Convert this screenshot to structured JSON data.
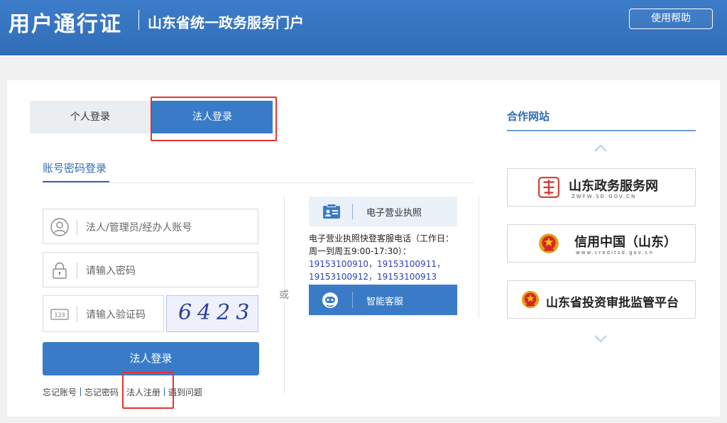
{
  "header": {
    "brand": "用户通行证",
    "subtitle": "山东省统一政务服务门户",
    "help_label": "使用帮助"
  },
  "tabs": {
    "person_label": "个人登录",
    "legal_label": "法人登录",
    "active": "法人登录"
  },
  "login": {
    "subtab_label": "账号密码登录",
    "account_placeholder": "法人/管理员/经办人账号",
    "password_placeholder": "请输入密码",
    "captcha_placeholder": "请输入验证码",
    "captcha_value": "6423",
    "captcha_icon_text": "123",
    "submit_label": "法人登录",
    "links": [
      "忘记账号",
      "忘记密码",
      "法人注册",
      "遇到问题"
    ]
  },
  "alt": {
    "or_label": "或",
    "elicense_label": "电子营业执照",
    "info_line1": "电子营业执照快登客服电话（工作日：",
    "info_line2": "周一到周五9:00-17:30）：",
    "phones_line1": "19153100910，19153100911，",
    "phones_line2": "19153100912，19153100913",
    "smart_service_label": "智能客服"
  },
  "partners": {
    "title": "合作网站",
    "sites": [
      {
        "name": "山东政务服务网",
        "url": "ZWFW.SD.GOV.CN",
        "logo": "sd-gov-service-logo"
      },
      {
        "name": "信用中国（山东）",
        "url": "www.creditsd.gov.cn",
        "logo": "national-emblem"
      },
      {
        "name": "山东省投资审批监管平台",
        "url": "",
        "logo": "national-emblem"
      }
    ]
  },
  "colors": {
    "header_blue": "#3d7cc9",
    "accent_blue": "#3a7bc8",
    "highlight_red": "#e8322f"
  }
}
